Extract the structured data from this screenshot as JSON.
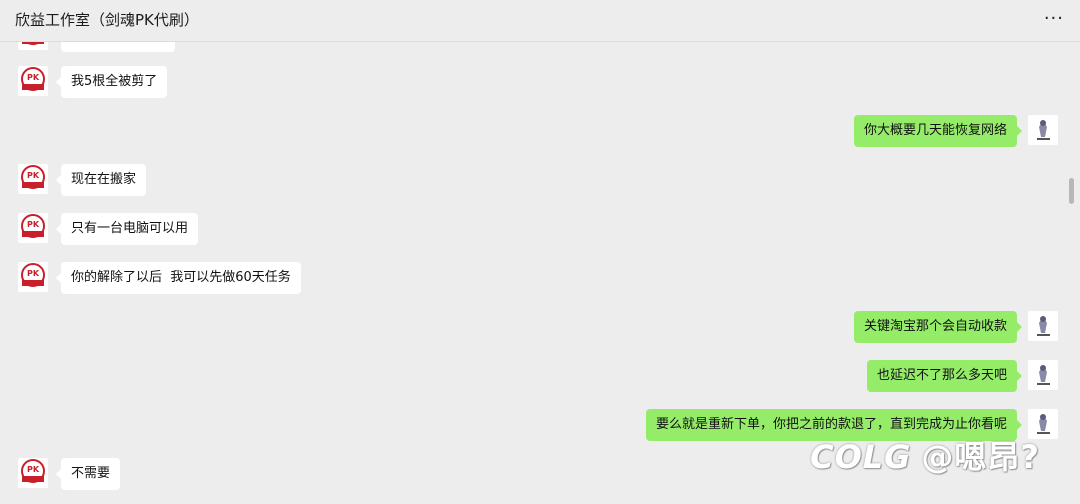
{
  "header": {
    "title": "欣益工作室（剑魂PK代刷）",
    "more_icon": "···"
  },
  "messages": [
    {
      "side": "left",
      "text": "我5根全被剪了"
    },
    {
      "side": "right",
      "text": "你大概要几天能恢复网络"
    },
    {
      "side": "left",
      "text": "现在在搬家"
    },
    {
      "side": "left",
      "text": "只有一台电脑可以用"
    },
    {
      "side": "left",
      "text": "你的解除了以后  我可以先做60天任务"
    },
    {
      "side": "right",
      "text": "关键淘宝那个会自动收款"
    },
    {
      "side": "right",
      "text": "也延迟不了那么多天吧"
    },
    {
      "side": "right",
      "text": "要么就是重新下单，你把之前的款退了，直到完成为止你看呢"
    },
    {
      "side": "left",
      "text": "不需要"
    }
  ],
  "watermark": {
    "logo": "COLG",
    "handle": "@嗯昂?"
  },
  "colors": {
    "background": "#ededed",
    "self_bubble": "#95ec69",
    "other_bubble": "#ffffff"
  }
}
